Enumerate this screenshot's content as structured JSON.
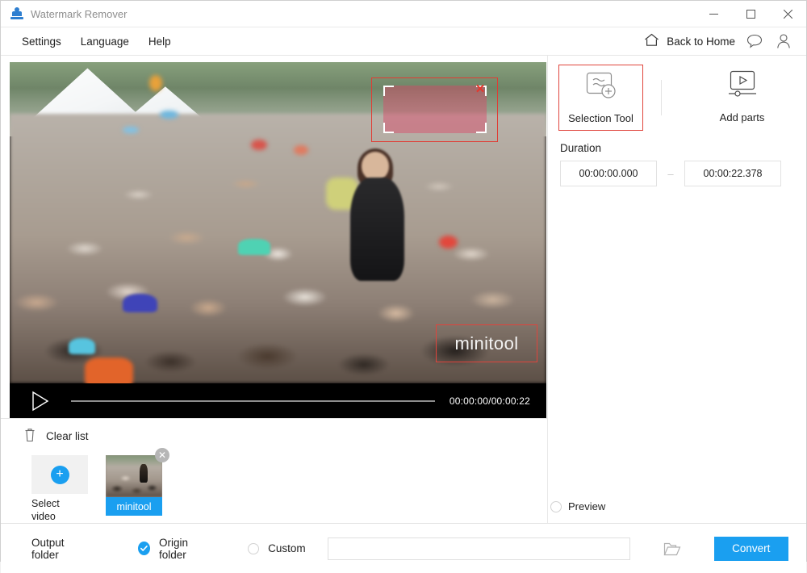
{
  "window": {
    "title": "Watermark Remover",
    "minimize_label": "—",
    "maximize_label": "□",
    "close_label": "✕"
  },
  "menubar": {
    "items": [
      {
        "label": "Settings"
      },
      {
        "label": "Language"
      },
      {
        "label": "Help"
      }
    ],
    "back_to_home": "Back to Home"
  },
  "player": {
    "time_display": "00:00:00/00:00:22",
    "watermark_text": "minitool",
    "selection_close": "✕"
  },
  "filelist": {
    "clear_list": "Clear list",
    "select_video_label": "Select\nvideo",
    "select_video_line1": "Select",
    "select_video_line2": "video",
    "plus": "+",
    "items": [
      {
        "name": "minitool",
        "close": "✕"
      }
    ]
  },
  "tools": {
    "selection_tool": "Selection Tool",
    "add_parts": "Add parts",
    "selected": "Selection Tool",
    "highlight_color": "#e0453d"
  },
  "duration": {
    "label": "Duration",
    "start": "00:00:00.000",
    "end": "00:00:22.378",
    "separator": "–"
  },
  "preview": {
    "label": "Preview",
    "checked": false
  },
  "footer": {
    "output_folder_label": "Output folder",
    "origin_folder_label": "Origin folder",
    "custom_label": "Custom",
    "path_value": "",
    "path_placeholder": "",
    "convert_label": "Convert",
    "accent_color": "#1a9ff0"
  }
}
